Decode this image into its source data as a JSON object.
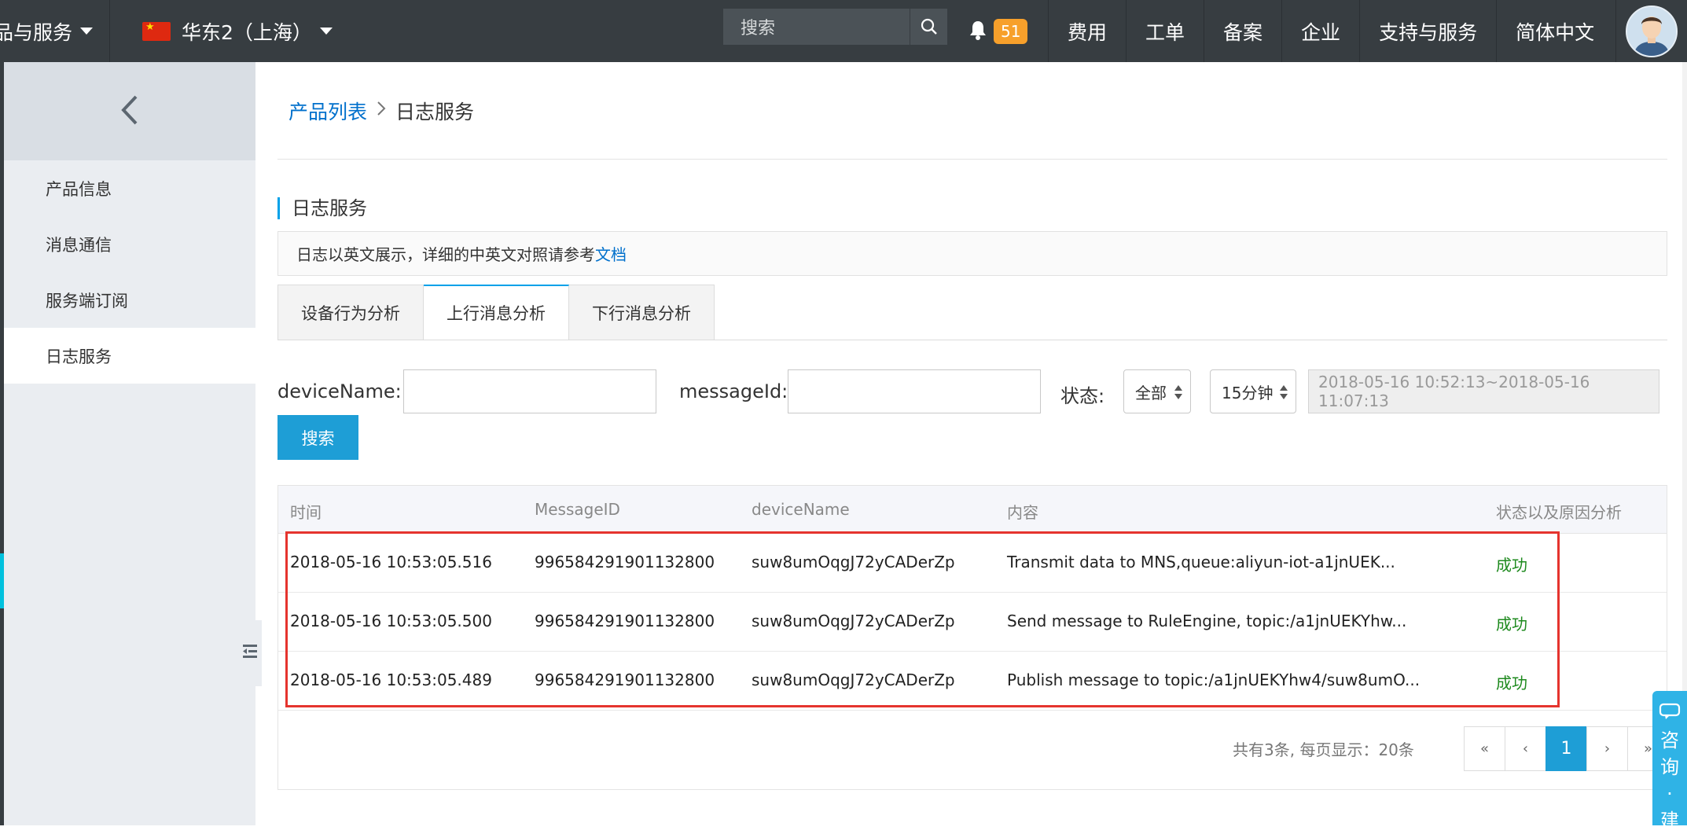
{
  "topbar": {
    "products_label": "品与服务",
    "region_label": "华东2（上海）",
    "search_placeholder": "搜索",
    "notification_count": "51",
    "menu": [
      "费用",
      "工单",
      "备案",
      "企业",
      "支持与服务",
      "简体中文"
    ]
  },
  "sidebar": {
    "items": [
      "产品信息",
      "消息通信",
      "服务端订阅",
      "日志服务"
    ],
    "active_index": 3
  },
  "breadcrumb": {
    "root": "产品列表",
    "current": "日志服务"
  },
  "section_title": "日志服务",
  "notice": {
    "text": "日志以英文展示，详细的中英文对照请参考",
    "link": "文档"
  },
  "tabs": [
    "设备行为分析",
    "上行消息分析",
    "下行消息分析"
  ],
  "active_tab": 1,
  "filters": {
    "device_label": "deviceName:",
    "device_value": "",
    "message_label": "messageId:",
    "message_value": "",
    "status_label": "状态:",
    "status_value": "全部",
    "range_value": "15分钟",
    "datetime_value": "2018-05-16 10:52:13~2018-05-16 11:07:13",
    "search_button": "搜索"
  },
  "table": {
    "headers": [
      "时间",
      "MessageID",
      "deviceName",
      "内容",
      "状态以及原因分析"
    ],
    "rows": [
      {
        "time": "2018-05-16 10:53:05.516",
        "message_id": "996584291901132800",
        "device_name": "suw8umOqgJ72yCADerZp",
        "content": "Transmit data to MNS,queue:aliyun-iot-a1jnUEK...",
        "status": "成功"
      },
      {
        "time": "2018-05-16 10:53:05.500",
        "message_id": "996584291901132800",
        "device_name": "suw8umOqgJ72yCADerZp",
        "content": "Send message to RuleEngine, topic:/a1jnUEKYhw...",
        "status": "成功"
      },
      {
        "time": "2018-05-16 10:53:05.489",
        "message_id": "996584291901132800",
        "device_name": "suw8umOqgJ72yCADerZp",
        "content": "Publish message to topic:/a1jnUEKYhw4/suw8umO...",
        "status": "成功"
      }
    ]
  },
  "pagination": {
    "summary": "共有3条, 每页显示：20条",
    "first": "«",
    "prev": "‹",
    "current": "1",
    "next": "›",
    "last": "»"
  },
  "consult": [
    "咨",
    "询",
    "·",
    "建"
  ],
  "colors": {
    "topbar_bg": "#373d41",
    "accent": "#1e9ed6",
    "success": "#1e8a1e",
    "highlight_border": "#e5342e",
    "badge": "#f7a02b"
  }
}
